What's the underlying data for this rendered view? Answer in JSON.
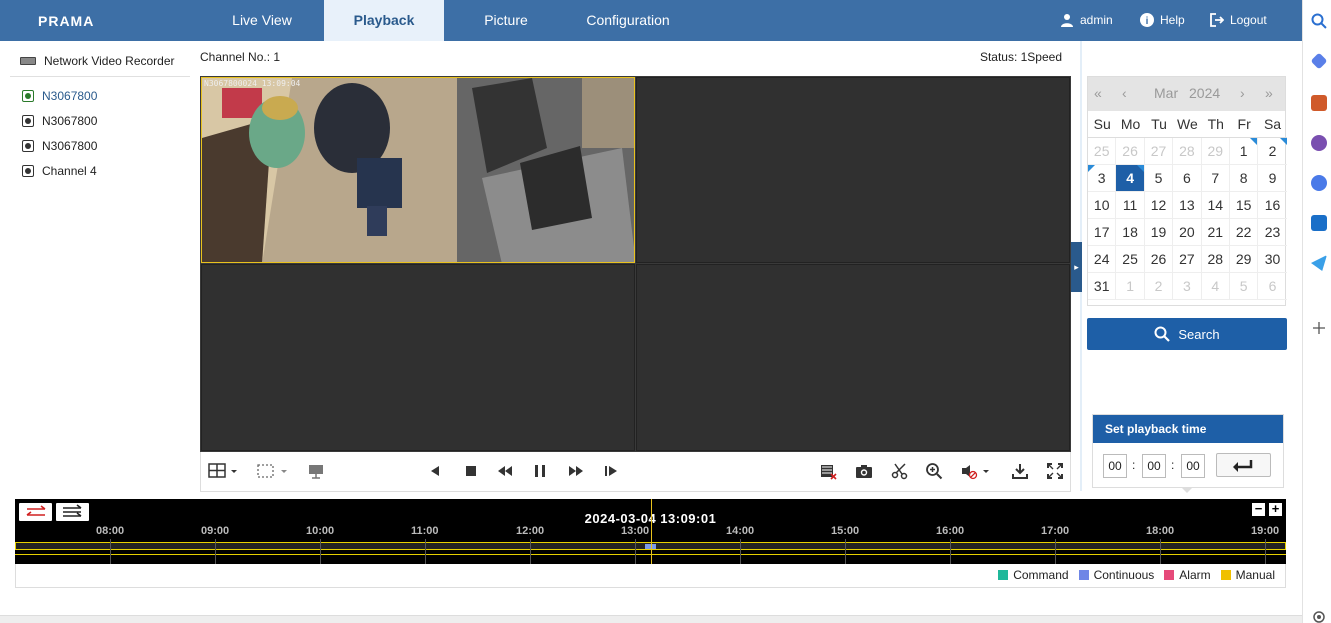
{
  "brand": "PRAMA",
  "nav": {
    "tabs": [
      "Live View",
      "Playback",
      "Picture",
      "Configuration"
    ],
    "active": "Playback"
  },
  "header_right": {
    "user": "admin",
    "help": "Help",
    "logout": "Logout"
  },
  "tree": {
    "root": "Network Video Recorder",
    "channels": [
      "N3067800",
      "N3067800",
      "N3067800",
      "Channel 4"
    ],
    "selected_index": 0
  },
  "video": {
    "channel_label": "Channel No.: 1",
    "status": "Status: 1Speed",
    "osd": "N3067800024 13:09:04"
  },
  "calendar": {
    "month": "Mar",
    "year": "2024",
    "weekdays": [
      "Su",
      "Mo",
      "Tu",
      "We",
      "Th",
      "Fr",
      "Sa"
    ],
    "weeks": [
      [
        "25",
        "26",
        "27",
        "28",
        "29",
        "1",
        "2"
      ],
      [
        "3",
        "4",
        "5",
        "6",
        "7",
        "8",
        "9"
      ],
      [
        "10",
        "11",
        "12",
        "13",
        "14",
        "15",
        "16"
      ],
      [
        "17",
        "18",
        "19",
        "20",
        "21",
        "22",
        "23"
      ],
      [
        "24",
        "25",
        "26",
        "27",
        "28",
        "29",
        "30"
      ],
      [
        "31",
        "1",
        "2",
        "3",
        "4",
        "5",
        "6"
      ]
    ],
    "selected_day": "4",
    "days_with_records": [
      "1",
      "2",
      "3",
      "4"
    ]
  },
  "search_label": "Search",
  "playback_time": {
    "title": "Set playback time",
    "hh": "00",
    "mm": "00",
    "ss": "00"
  },
  "timeline": {
    "current": "2024-03-04 13:09:01",
    "hours": [
      "08:00",
      "09:00",
      "10:00",
      "11:00",
      "12:00",
      "13:00",
      "14:00",
      "15:00",
      "16:00",
      "17:00",
      "18:00",
      "19:00"
    ]
  },
  "legend": [
    {
      "label": "Command",
      "color": "#1fb89a"
    },
    {
      "label": "Continuous",
      "color": "#6f86e6"
    },
    {
      "label": "Alarm",
      "color": "#e64a7a"
    },
    {
      "label": "Manual",
      "color": "#f0c000"
    }
  ],
  "colors": {
    "header": "#3d6fa6",
    "accent": "#1e5fa7",
    "selection": "#e9c21d"
  }
}
